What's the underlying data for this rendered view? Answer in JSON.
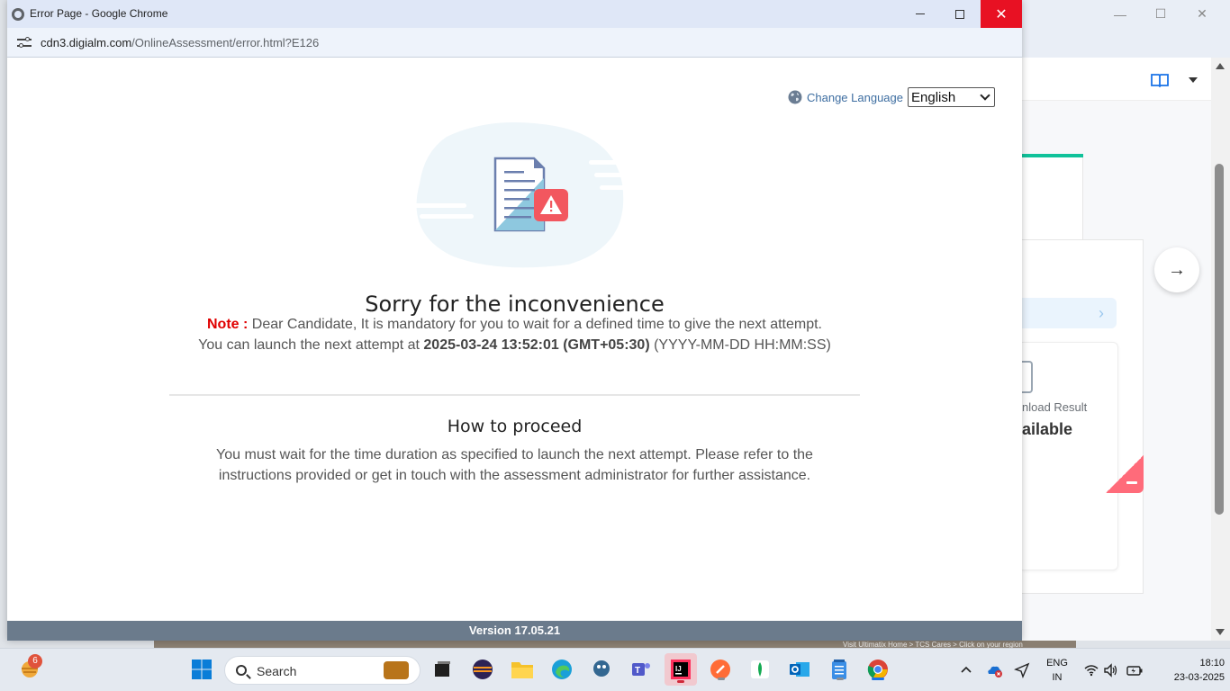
{
  "window": {
    "title": "Error Page - Google Chrome",
    "close_glyph": "✕"
  },
  "address_bar": {
    "host": "cdn3.digialm.com",
    "path": "/OnlineAssessment/error.html?E126"
  },
  "language": {
    "label": "Change Language",
    "selected": "English"
  },
  "error": {
    "title": "Sorry for the inconvenience",
    "note_label": "Note :",
    "note_text": " Dear Candidate, It is mandatory for you to wait for a defined time to give the next attempt.",
    "attempt_prefix": "You can launch the next attempt at ",
    "attempt_datetime": "2025-03-24 13:52:01 (GMT+05:30)",
    "attempt_format": " (YYYY-MM-DD HH:MM:SS)"
  },
  "proceed": {
    "title": "How to proceed",
    "text": "You must wait for the time duration as specified to launch the next attempt. Please refer to the instructions provided or get in touch with the assessment administrator for further assistance."
  },
  "footer": {
    "version": "Version 17.05.21"
  },
  "background_window": {
    "download_label": "nload Result",
    "status": "ailable",
    "footer_text": "Visit Ultimatix Home > TCS Cares > Click on your region"
  },
  "taskbar": {
    "weather_badge": "6",
    "search_label": "Search",
    "lang_line1": "ENG",
    "lang_line2": "IN",
    "time": "18:10",
    "date": "23-03-2025"
  },
  "colors": {
    "error_red": "#e00000",
    "footer_bar": "#6b7b8c",
    "close_red": "#e81123",
    "link_blue": "#3e6ea1"
  }
}
